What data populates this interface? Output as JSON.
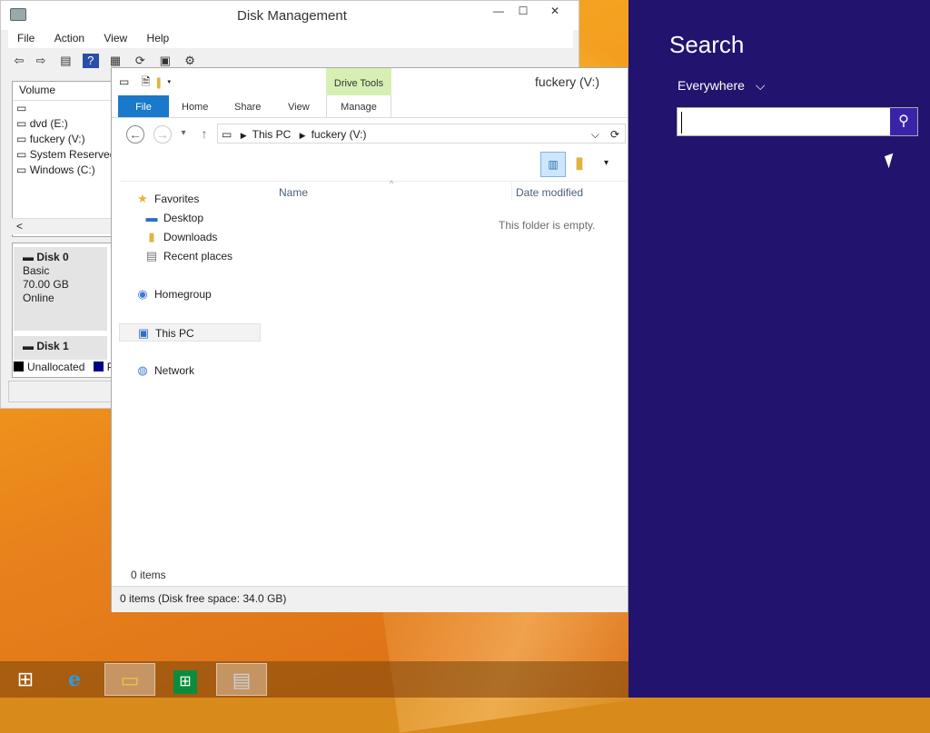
{
  "disk_management": {
    "title": "Disk Management",
    "min_glyph": "—",
    "max_glyph": "☐",
    "close_glyph": "✕",
    "menu": [
      "File",
      "Action",
      "View",
      "Help"
    ],
    "volume_header": "Volume",
    "volumes": [
      "",
      "dvd (E:)",
      "fuckery (V:)",
      "System Reserved",
      "Windows (C:)"
    ],
    "scroll_left_glyph": "<",
    "disks": [
      {
        "name": "Disk 0",
        "type": "Basic",
        "size": "70.00 GB",
        "status": "Online"
      },
      {
        "name": "Disk 1"
      }
    ],
    "legend": [
      {
        "label": "Unallocated",
        "color": "#000000"
      },
      {
        "label": "P",
        "color": "#00008b"
      }
    ]
  },
  "explorer": {
    "title": "fuckery (V:)",
    "drive_tools_label": "Drive Tools",
    "ribbon_tabs": {
      "file": "File",
      "home": "Home",
      "share": "Share",
      "view": "View",
      "manage": "Manage"
    },
    "breadcrumb": [
      "This PC",
      "fuckery (V:)"
    ],
    "nav_items": {
      "favorites": "Favorites",
      "desktop": "Desktop",
      "downloads": "Downloads",
      "recent": "Recent places",
      "homegroup": "Homegroup",
      "this_pc": "This PC",
      "network": "Network"
    },
    "columns": {
      "name": "Name",
      "date_modified": "Date modified"
    },
    "empty_text": "This folder is empty.",
    "item_count": "0 items",
    "status_text": "0 items (Disk free space: 34.0 GB)"
  },
  "taskbar": {
    "items": [
      "start-button",
      "internet-explorer",
      "file-explorer",
      "store",
      "disk-management"
    ]
  },
  "search_charm": {
    "heading": "Search",
    "scope": "Everywhere",
    "scope_chevron": "⌵",
    "query": "",
    "bg_color": "#22136e"
  }
}
